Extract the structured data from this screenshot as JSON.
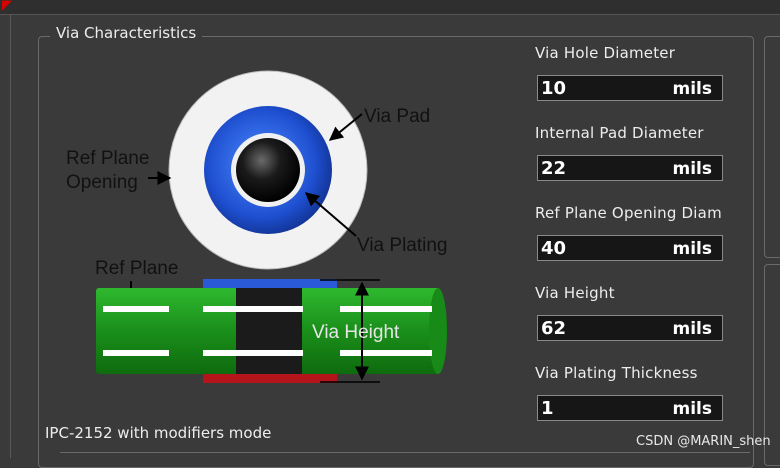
{
  "group": {
    "title": "Via Characteristics"
  },
  "diagram": {
    "via_pad": "Via Pad",
    "ref_plane_opening": [
      "Ref Plane",
      "Opening"
    ],
    "via_plating": "Via Plating",
    "ref_plane": "Ref Plane",
    "via_height": "Via Height"
  },
  "fields": [
    {
      "label": "Via Hole Diameter",
      "value": "10",
      "unit": "mils"
    },
    {
      "label": "Internal Pad Diameter",
      "value": "22",
      "unit": "mils"
    },
    {
      "label": "Ref Plane Opening Diam",
      "value": "40",
      "unit": "mils"
    },
    {
      "label": "Via Height",
      "value": "62",
      "unit": "mils"
    },
    {
      "label": "Via Plating Thickness",
      "value": "1",
      "unit": "mils"
    }
  ],
  "mode_text": "IPC-2152 with modifiers mode",
  "watermark": "CSDN @MARIN_shen",
  "colors": {
    "background": "#3a3a3a",
    "pad_blue": "#2a5ad8",
    "board_green": "#1f9a1f",
    "plane_red": "#b3151a"
  }
}
